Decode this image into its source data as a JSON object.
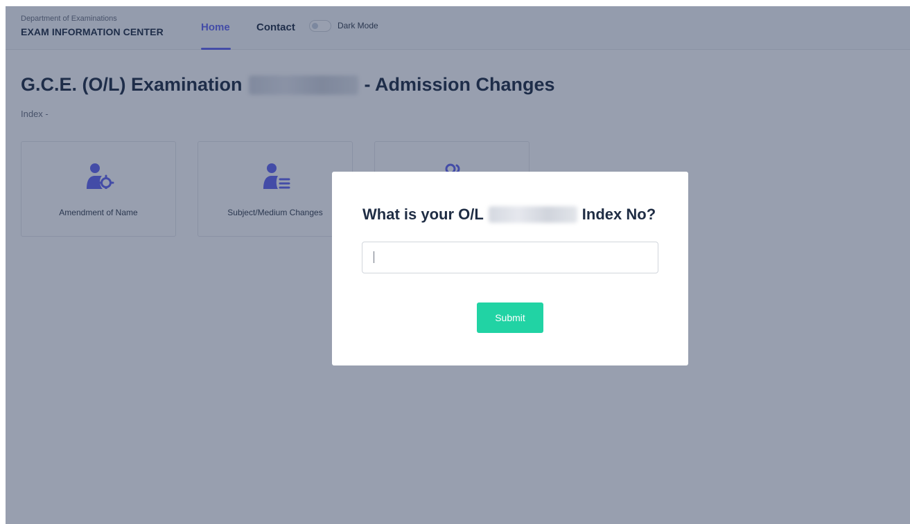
{
  "header": {
    "org_name": "Department of Examinations",
    "site_title": "EXAM INFORMATION CENTER",
    "nav": {
      "home_label": "Home",
      "contact_label": "Contact"
    },
    "dark_mode_label": "Dark Mode",
    "dark_mode_on": false
  },
  "main": {
    "title_prefix": "G.C.E. (O/L) Examination",
    "title_suffix": "- Admission Changes",
    "index_label": "Index -",
    "cards": [
      {
        "label": "Amendment of Name",
        "icon": "user-gear-icon"
      },
      {
        "label": "Subject/Medium Changes",
        "icon": "user-list-icon"
      },
      {
        "label": "",
        "icon": "users-icon"
      }
    ]
  },
  "modal": {
    "question_prefix": "What is your O/L",
    "question_suffix": "Index No?",
    "input_value": "",
    "submit_label": "Submit"
  },
  "colors": {
    "accent": "#6366f1",
    "submit": "#21d3a4",
    "icon": "#6366f1",
    "title": "#1f2d44"
  }
}
